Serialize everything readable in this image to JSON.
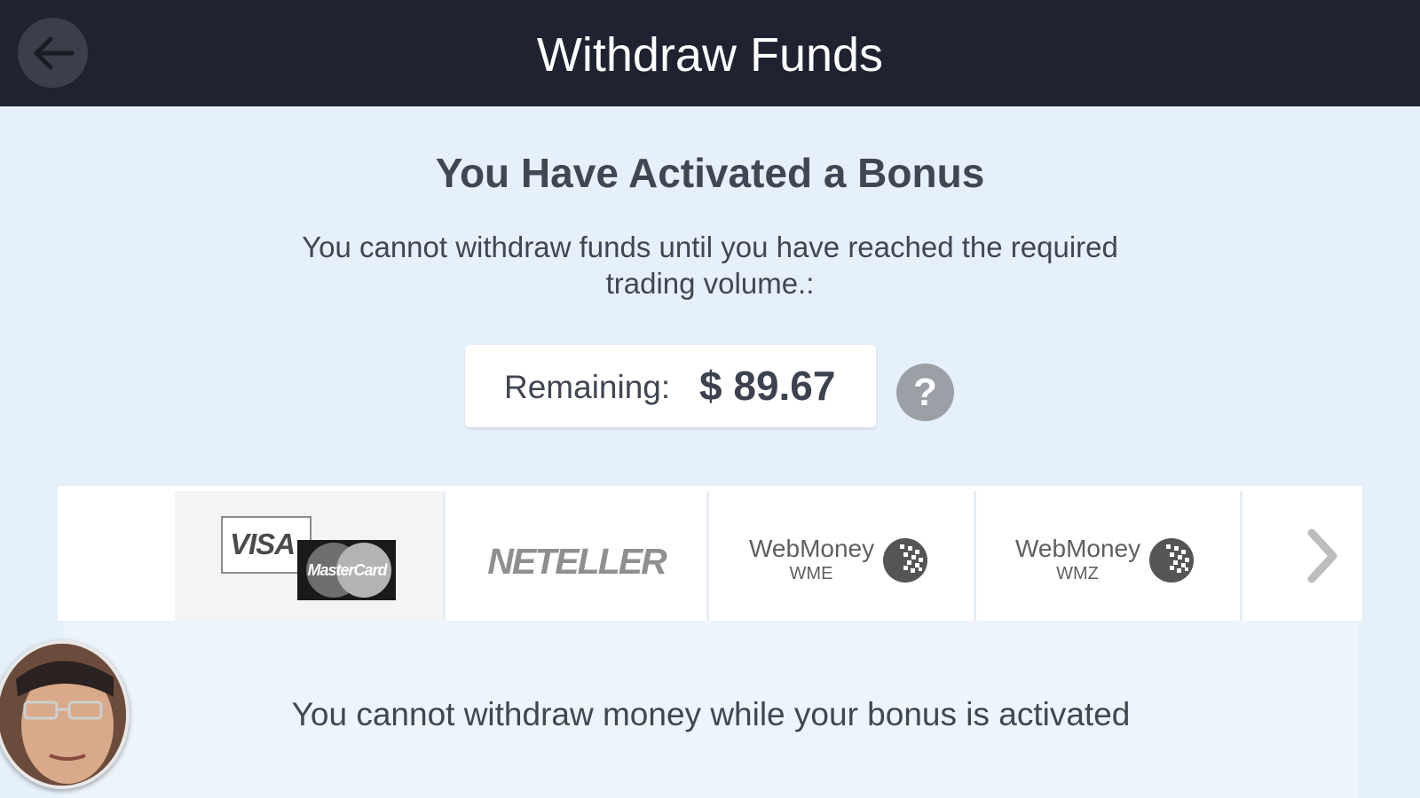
{
  "header": {
    "title": "Withdraw Funds",
    "back_icon": "arrow-left-icon"
  },
  "bonus": {
    "title": "You Have Activated a Bonus",
    "description": "You cannot withdraw funds until you have reached the required trading volume.:",
    "remaining_label": "Remaining:",
    "remaining_amount": "$ 89.67",
    "help_label": "?"
  },
  "payment_methods": [
    {
      "name": "VISA / MasterCard",
      "visa_label": "VISA",
      "mastercard_label": "MasterCard",
      "selected": true
    },
    {
      "name": "NETELLER",
      "label": "NETELLER",
      "selected": false
    },
    {
      "name": "WebMoney WME",
      "label": "WebMoney",
      "code": "WME",
      "selected": false
    },
    {
      "name": "WebMoney WMZ",
      "label": "WebMoney",
      "code": "WMZ",
      "selected": false
    }
  ],
  "next_icon": "chevron-right-icon",
  "message": "You cannot withdraw money while your bonus is activated",
  "colors": {
    "header_bg": "#1f2230",
    "page_bg": "#e5f0fb",
    "text": "#404652",
    "help_bg": "#9aa0a6"
  }
}
